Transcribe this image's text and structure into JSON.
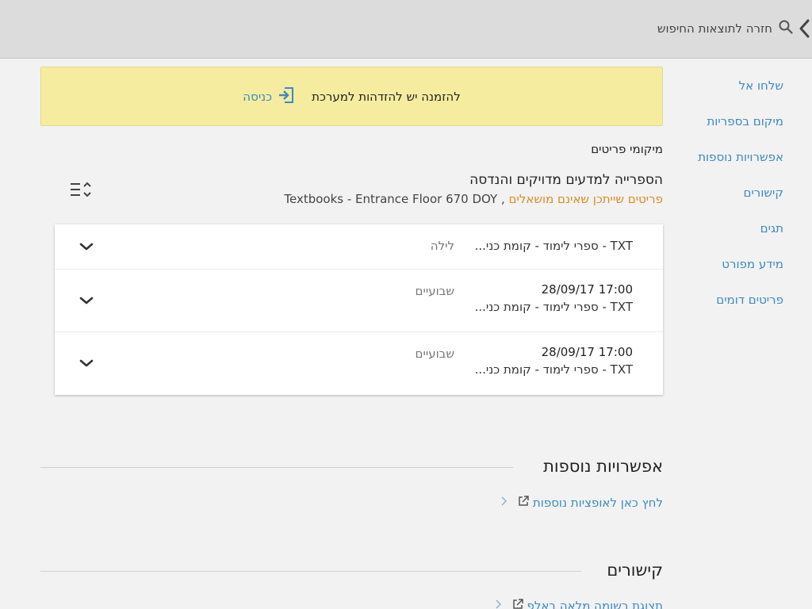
{
  "header": {
    "back_label": "חזרה לתוצאות החיפוש",
    "back_icon": "chevron-left-icon",
    "search_icon": "search-icon"
  },
  "sidenav": {
    "items": [
      {
        "label": "שלחו אל"
      },
      {
        "label": "מיקום בספריות"
      },
      {
        "label": "אפשרויות נוספות"
      },
      {
        "label": "קישורים"
      },
      {
        "label": "תגים"
      },
      {
        "label": "מידע מפורט"
      },
      {
        "label": "פריטים דומים"
      }
    ]
  },
  "notice": {
    "message": "להזמנה יש להזדהות למערכת",
    "signin_label": "כניסה",
    "signin_icon": "sign-in-icon"
  },
  "locations": {
    "title": "מיקומי פריטים",
    "library_name": "הספרייה למדעים מדויקים והנדסה",
    "availability": "פריטים שייתכן שאינם מושאלים",
    "separator": " , ",
    "location": "Textbooks - Entrance Floor 670 DOY",
    "sort_icon": "sort-options-icon"
  },
  "items": [
    {
      "due": "",
      "location": "TXT - ספרי לימוד - קומת כני...",
      "policy": "לילה"
    },
    {
      "due": "17:00 28/09/17",
      "location": "TXT - ספרי לימוד - קומת כני...",
      "policy": "שבועיים"
    },
    {
      "due": "17:00 28/09/17",
      "location": "TXT - ספרי לימוד - קומת כני...",
      "policy": "שבועיים"
    }
  ],
  "more_options": {
    "heading": "אפשרויות נוספות",
    "link_label": "לחץ כאן לאופציות נוספות",
    "link_icon": "external-link-icon"
  },
  "links": {
    "heading": "קישורים",
    "link_label": "תצוגת רשומה מלאה באלפ"
  },
  "colors": {
    "accent": "#3d8ac2",
    "warning_bg": "#f5ec9f",
    "availability": "#e08a1e"
  }
}
